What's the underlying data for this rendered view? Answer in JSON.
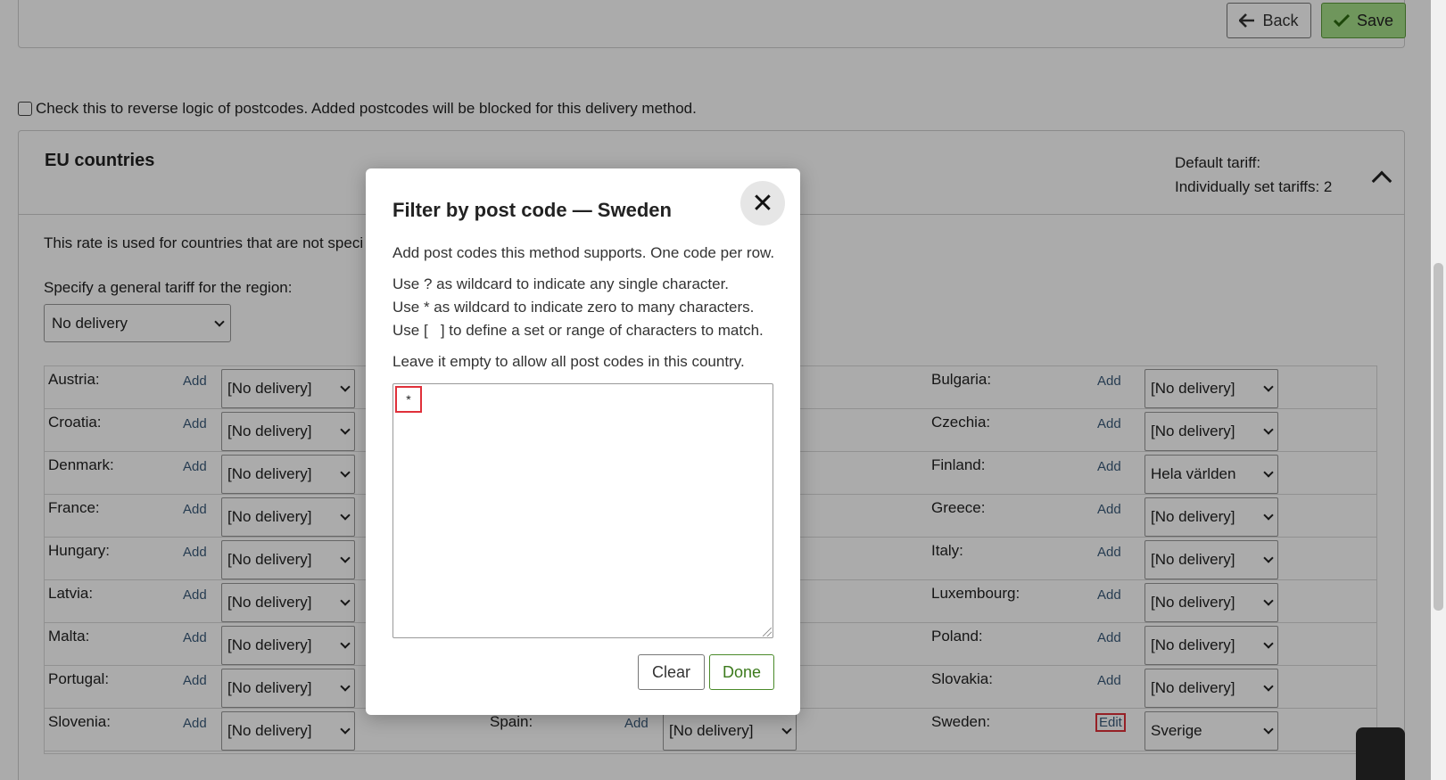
{
  "toolbar": {
    "back_label": "Back",
    "back_icon": "arrow-left-icon",
    "save_label": "Save",
    "save_icon": "check-icon"
  },
  "reverse_logic": {
    "label": "Check this to reverse logic of postcodes. Added postcodes will be blocked for this delivery method.",
    "checked": false
  },
  "region": {
    "title": "EU countries",
    "default_tariff_label": "Default tariff:",
    "individual_tariffs_label": "Individually set tariffs: 2",
    "rate_description": "This rate is used for countries that are not speci",
    "general_tariff_label": "Specify a general tariff for the region:",
    "general_tariff_value": "No delivery"
  },
  "countries": [
    {
      "name": "Austria:",
      "action": "Add",
      "tariff": "[No delivery]"
    },
    {
      "name": "Bulgaria:",
      "action": "Add",
      "tariff": "[No delivery]"
    },
    {
      "name": "Croatia:",
      "action": "Add",
      "tariff": "[No delivery]"
    },
    {
      "name": "Czechia:",
      "action": "Add",
      "tariff": "[No delivery]"
    },
    {
      "name": "Denmark:",
      "action": "Add",
      "tariff": "[No delivery]"
    },
    {
      "name": "Finland:",
      "action": "Add",
      "tariff": "Hela världen"
    },
    {
      "name": "France:",
      "action": "Add",
      "tariff": "[No delivery]"
    },
    {
      "name": "Greece:",
      "action": "Add",
      "tariff": "[No delivery]"
    },
    {
      "name": "Hungary:",
      "action": "Add",
      "tariff": "[No delivery]"
    },
    {
      "name": "Italy:",
      "action": "Add",
      "tariff": "[No delivery]"
    },
    {
      "name": "Latvia:",
      "action": "Add",
      "tariff": "[No delivery]"
    },
    {
      "name": "Luxembourg:",
      "action": "Add",
      "tariff": "[No delivery]"
    },
    {
      "name": "Malta:",
      "action": "Add",
      "tariff": "[No delivery]"
    },
    {
      "name": "Poland:",
      "action": "Add",
      "tariff": "[No delivery]"
    },
    {
      "name": "Portugal:",
      "action": "Add",
      "tariff": "[No delivery]"
    },
    {
      "name": "Slovakia:",
      "action": "Add",
      "tariff": "[No delivery]"
    },
    {
      "name": "Slovenia:",
      "action": "Add",
      "tariff": "[No delivery]"
    },
    {
      "name": "Spain:",
      "action": "Add",
      "tariff": "[No delivery]"
    },
    {
      "name": "Sweden:",
      "action": "Edit",
      "tariff": "Sverige"
    }
  ],
  "modal": {
    "title": "Filter by post code — Sweden",
    "close_icon": "close-icon",
    "intro": "Add post codes this method supports. One code per row.",
    "wildcard_single": "Use ? as wildcard to indicate any single character.",
    "wildcard_many": "Use * as wildcard to indicate zero to many characters.",
    "wildcard_set": "Use [   ] to define a set or range of characters to match.",
    "empty_note": "Leave it empty to allow all post codes in this country.",
    "postcodes_value": "*",
    "clear_label": "Clear",
    "done_label": "Done"
  },
  "colors": {
    "save_bg": "#a6e08a",
    "highlight": "#e0303a",
    "done_text": "#3c7a1c",
    "overlay": "rgba(0,0,0,0.33)"
  }
}
